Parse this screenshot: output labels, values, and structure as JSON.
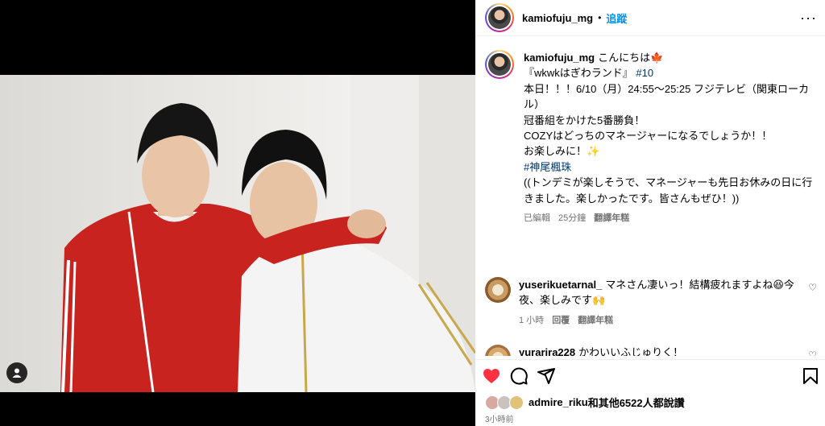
{
  "header": {
    "username": "kamiofuju_mg",
    "dot": "•",
    "follow_label": "追蹤",
    "more": "···"
  },
  "caption": {
    "username": "kamiofuju_mg",
    "greeting": "こんにちは🍁",
    "lines": [
      "",
      "『wkwkはぎわランド』",
      "本日！！！6/10（月）24:55～25:25 フジテレビ（関東ローカル）",
      "冠番組をかけた5番勝負！",
      "COZYはどっちのマネージャーになるでしょうか！！",
      "",
      "お楽しみに！✨",
      "",
      "",
      "",
      "((トンデミが楽しそうで、マネージャーも先日お休みの日に行きました。楽しかったです。皆さんもぜひ！))"
    ],
    "episode_tag": "#10",
    "hashtag": "#神尾楓珠",
    "meta_edited": "已編輯",
    "meta_time": "25分鐘",
    "meta_translate": "翻譯年糕"
  },
  "comments": [
    {
      "username": "yuserikuetarnal_",
      "text": "マネさん凄いっ！結構疲れますよね😆今夜、楽しみです🙌",
      "time": "1 小時",
      "reply": "回覆",
      "translate": "翻譯年糕"
    },
    {
      "username": "yurarira228",
      "text": "かわいいふじゅりく！"
    }
  ],
  "likes": {
    "user": "admire_riku",
    "rest": "和其他6522人都說讚"
  },
  "post_time": "3小時前",
  "icons": {
    "like": "heart-filled-icon",
    "comment": "comment-icon",
    "share": "send-icon",
    "save": "bookmark-icon",
    "tag": "user-tag-icon"
  },
  "colors": {
    "like_red": "#ff3040",
    "follow_blue": "#0095f6",
    "hashtag": "#00376b"
  }
}
